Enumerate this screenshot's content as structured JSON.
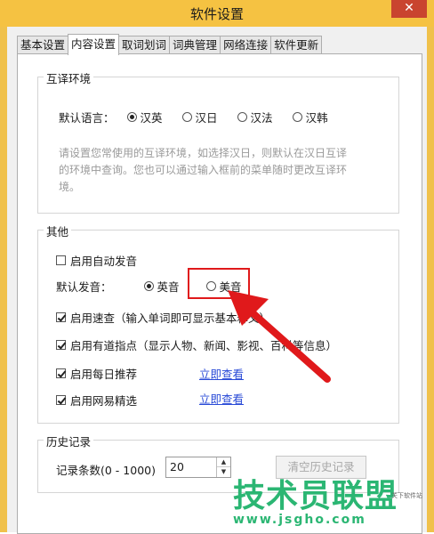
{
  "window": {
    "title": "软件设置",
    "close": "✕"
  },
  "tabs": [
    {
      "label": "基本设置",
      "active": false
    },
    {
      "label": "内容设置",
      "active": true
    },
    {
      "label": "取词划词",
      "active": false
    },
    {
      "label": "词典管理",
      "active": false
    },
    {
      "label": "网络连接",
      "active": false
    },
    {
      "label": "软件更新",
      "active": false
    }
  ],
  "translate_env": {
    "title": "互译环境",
    "default_lang_label": "默认语言：",
    "options": [
      "汉英",
      "汉日",
      "汉法",
      "汉韩"
    ],
    "selected": "汉英",
    "hint": [
      "请设置您常使用的互译环境，如选择汉日，则默认在汉日互译",
      "的环境中查询。您也可以通过输入框前的菜单随时更改互译环",
      "境。"
    ]
  },
  "other": {
    "title": "其他",
    "auto_pronounce": {
      "label": "启用自动发音",
      "checked": false
    },
    "default_voice_label": "默认发音：",
    "voice_options": [
      "英音",
      "美音"
    ],
    "voice_selected": "英音",
    "quick_lookup": {
      "label": "启用速查（输入单词即可显示基本释义）",
      "checked": true
    },
    "youdao_tips": {
      "label": "启用有道指点（显示人物、新闻、影视、百科等信息）",
      "checked": true
    },
    "daily_recommend": {
      "label": "启用每日推荐",
      "checked": true,
      "link": "立即查看"
    },
    "netease_select": {
      "label": "启用网易精选",
      "checked": true,
      "link": "立即查看"
    }
  },
  "history": {
    "title": "历史记录",
    "count_label": "记录条数(0 - 1000)",
    "count_value": "20",
    "clear_button": "清空历史记录"
  },
  "watermark": {
    "text": "技术员联盟",
    "url": "www.jsgho.com",
    "small": "关下软件站"
  },
  "colors": {
    "titlebar": "#f5c242",
    "close": "#c9442f",
    "link": "#2a4bd7",
    "highlight": "#e0191b",
    "watermark": "#2bb673"
  }
}
